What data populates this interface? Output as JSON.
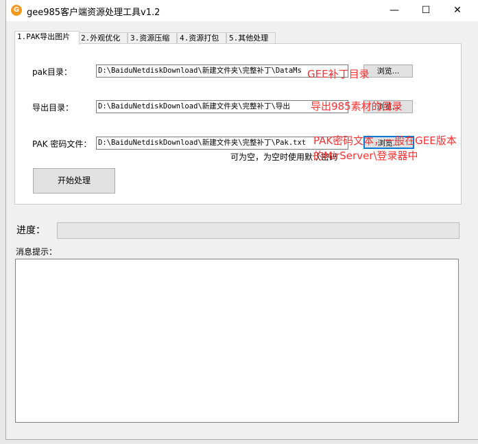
{
  "window": {
    "title": "gee985客户端资源处理工具v1.2",
    "minimize": "—",
    "maximize": "☐",
    "close": "✕"
  },
  "tabs": [
    {
      "label": "1.PAK导出图片"
    },
    {
      "label": "2.外观优化"
    },
    {
      "label": "3.资源压缩"
    },
    {
      "label": "4.资源打包"
    },
    {
      "label": "5.其他处理"
    }
  ],
  "form": {
    "pak_dir": {
      "label": "pak目录：",
      "value": "D:\\BaiduNetdiskDownload\\新建文件夹\\完整补丁\\DataMs",
      "browse": "浏览..."
    },
    "export_dir": {
      "label": "导出目录：",
      "value": "D:\\BaiduNetdiskDownload\\新建文件夹\\完整补丁\\导出",
      "browse": "浏览..."
    },
    "pak_pwd": {
      "label": "PAK 密码文件：",
      "value": "D:\\BaiduNetdiskDownload\\新建文件夹\\完整补丁\\Pak.txt",
      "browse": "浏览..."
    },
    "hint": "可为空，为空时使用默认密码",
    "start": "开始处理"
  },
  "annotations": {
    "a1": "GEE补丁目录",
    "a2": "导出985素材的目录",
    "a3": "PAK密码文本，一般在GEE版本",
    "a4": "的MirServer\\登录器中",
    "color": "#ff3030"
  },
  "progress": {
    "label": "进度：",
    "value": 0
  },
  "messages": {
    "label": "消息提示：",
    "content": ""
  }
}
